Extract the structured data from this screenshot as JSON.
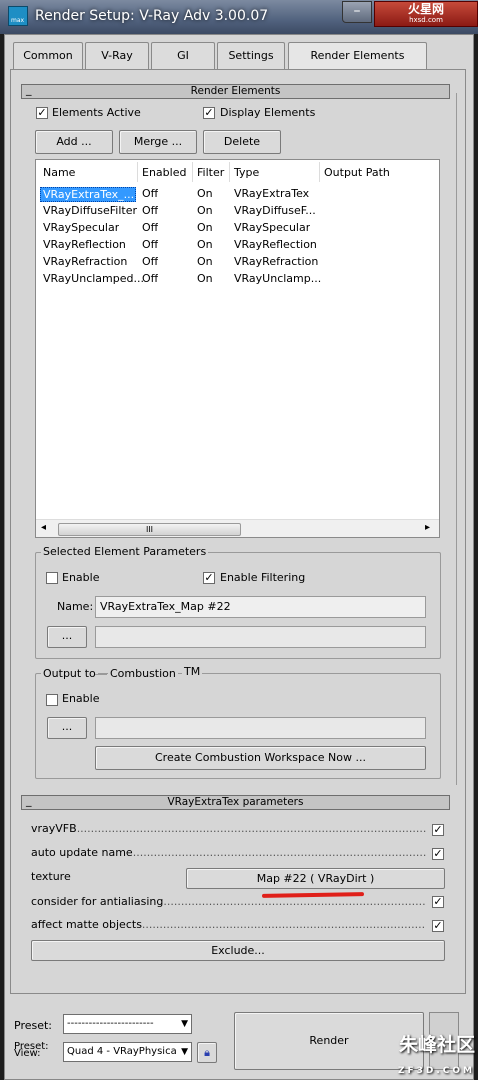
{
  "window": {
    "title": "Render Setup: V-Ray Adv 3.00.07",
    "app_icon_label": "max",
    "minimize_glyph": "–",
    "watermark_top": "火星网",
    "watermark_top_sub": "hxsd.com"
  },
  "tabs": [
    {
      "label": "Common"
    },
    {
      "label": "V-Ray"
    },
    {
      "label": "GI"
    },
    {
      "label": "Settings"
    },
    {
      "label": "Render Elements"
    }
  ],
  "render_elements": {
    "rollout_title": "Render Elements",
    "elements_active": {
      "label": "Elements Active",
      "checked": true
    },
    "display_elements": {
      "label": "Display Elements",
      "checked": true
    },
    "add_label": "Add ...",
    "merge_label": "Merge ...",
    "delete_label": "Delete",
    "columns": [
      "Name",
      "Enabled",
      "Filter",
      "Type",
      "Output Path"
    ],
    "rows": [
      [
        "VRayExtraTex_...",
        "Off",
        "On",
        "VRayExtraTex",
        ""
      ],
      [
        "VRayDiffuseFilter",
        "Off",
        "On",
        "VRayDiffuseF...",
        ""
      ],
      [
        "VRaySpecular",
        "Off",
        "On",
        "VRaySpecular",
        ""
      ],
      [
        "VRayReflection",
        "Off",
        "On",
        "VRayReflection",
        ""
      ],
      [
        "VRayRefraction",
        "Off",
        "On",
        "VRayRefraction",
        ""
      ],
      [
        "VRayUnclamped...",
        "Off",
        "On",
        "VRayUnclamp...",
        ""
      ]
    ],
    "scroll_left": "◂",
    "scroll_right": "▸",
    "scroll_grip": "III"
  },
  "selected_params": {
    "group_title": "Selected Element Parameters",
    "enable": {
      "label": "Enable",
      "checked": false
    },
    "enable_filtering": {
      "label": "Enable Filtering",
      "checked": true
    },
    "name_label": "Name:",
    "name_value": "VRayExtraTex_Map #22",
    "browse_label": "...",
    "path_value": ""
  },
  "output_to": {
    "group_title": "Output to",
    "combustion_label": "Combustion",
    "tm_label": "TM",
    "enable": {
      "label": "Enable",
      "checked": false
    },
    "browse_label": "...",
    "path_value": "",
    "create_workspace_label": "Create Combustion Workspace Now ..."
  },
  "extratex": {
    "rollout_title": "VRayExtraTex parameters",
    "vrayvfb": {
      "label": "vrayVFB",
      "checked": true
    },
    "auto_update_name": {
      "label": "auto update name",
      "checked": true
    },
    "texture_label": "texture",
    "texture_button": "Map #22  ( VRayDirt )",
    "consider_aa": {
      "label": "consider for antialiasing",
      "checked": true
    },
    "affect_matte": {
      "label": "affect matte objects",
      "checked": true
    },
    "exclude_label": "Exclude..."
  },
  "bottom": {
    "preset_label": "Preset:",
    "preset_value": "------------------------",
    "view_label": "View:",
    "view_label_overlap": "Preset:",
    "view_value": "Quad 4 - VRayPhysica",
    "render_label": "Render",
    "watermark_bottom": "朱峰社区",
    "watermark_bottom_sub": "ZF3D.COM"
  },
  "colors": {
    "selection": "#3399ff",
    "underline": "#e0201a"
  }
}
